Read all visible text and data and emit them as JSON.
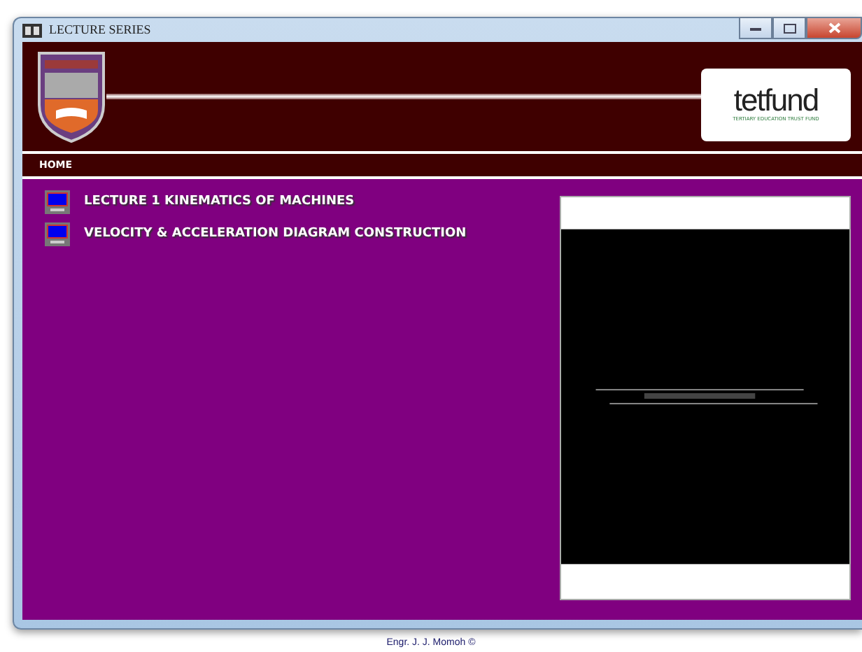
{
  "window": {
    "title": "LECTURE SERIES"
  },
  "header": {
    "logo_text": "tetfund",
    "logo_subtitle": "TERTIARY EDUCATION TRUST FUND"
  },
  "nav": [
    {
      "label": "HOME"
    }
  ],
  "lectures": [
    {
      "title": "LECTURE 1 KINEMATICS OF MACHINES"
    },
    {
      "title": "VELOCITY & ACCELERATION DIAGRAM CONSTRUCTION"
    }
  ],
  "footer": "Engr. J. J. Momoh ©"
}
